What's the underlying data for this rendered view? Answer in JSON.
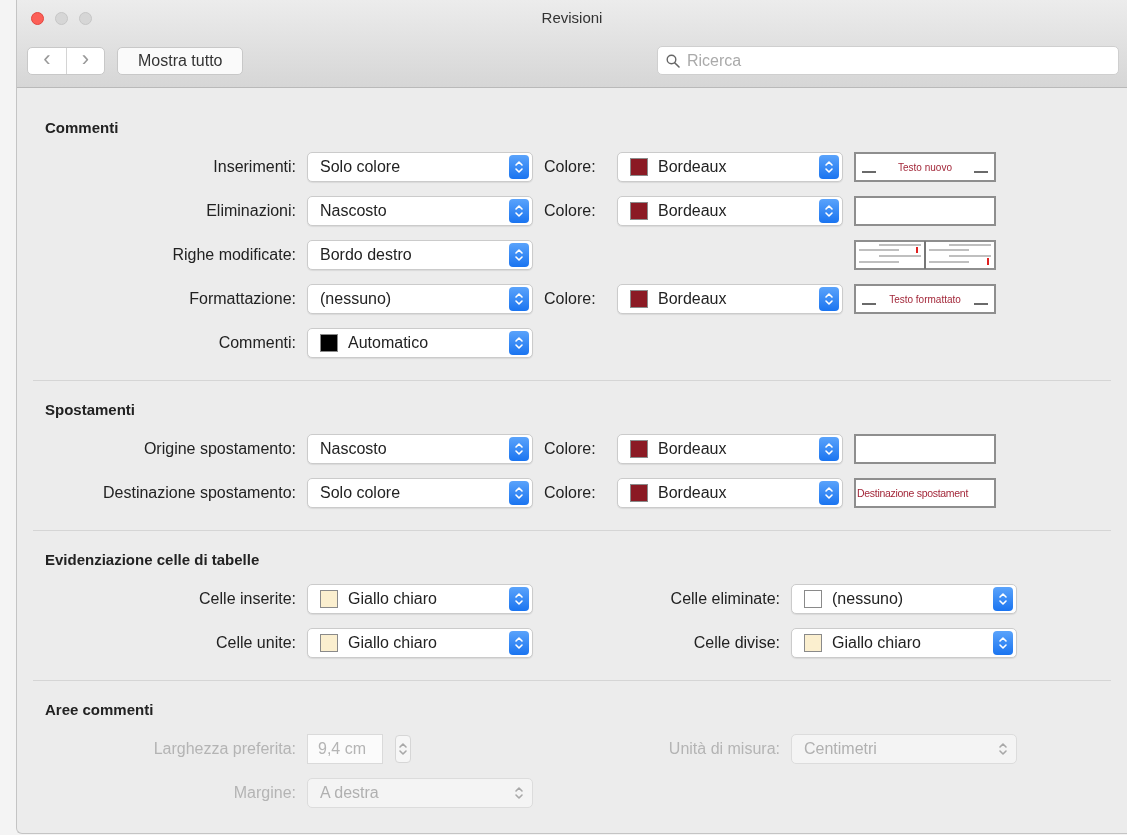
{
  "window": {
    "title": "Revisioni"
  },
  "toolbar": {
    "back": "‹",
    "forward": "›",
    "show_all": "Mostra tutto",
    "search": {
      "placeholder": "Ricerca"
    }
  },
  "sections": [
    {
      "kind": "revisions",
      "title": "Commenti",
      "rows": [
        {
          "label": "Inserimenti:",
          "mode": {
            "value": "Solo colore"
          },
          "color": {
            "label": "Colore:",
            "value": "Bordeaux",
            "color": "#8b1a24"
          },
          "preview": {
            "kind": "marked",
            "text": "Testo nuovo"
          }
        },
        {
          "label": "Eliminazioni:",
          "mode": {
            "value": "Nascosto"
          },
          "color": {
            "label": "Colore:",
            "value": "Bordeaux",
            "color": "#8b1a24"
          },
          "preview": {
            "kind": "empty"
          }
        },
        {
          "label": "Righe modificate:",
          "mode": {
            "value": "Bordo destro"
          },
          "preview": {
            "kind": "lines"
          }
        },
        {
          "label": "Formattazione:",
          "mode": {
            "value": "(nessuno)"
          },
          "color": {
            "label": "Colore:",
            "value": "Bordeaux",
            "color": "#8b1a24"
          },
          "preview": {
            "kind": "marked",
            "text": "Testo formattato"
          }
        },
        {
          "label": "Commenti:",
          "mode": {
            "value": "Automatico",
            "color": "#000000"
          }
        }
      ]
    },
    {
      "kind": "revisions",
      "title": "Spostamenti",
      "rows": [
        {
          "label": "Origine spostamento:",
          "mode": {
            "value": "Nascosto"
          },
          "color": {
            "label": "Colore:",
            "value": "Bordeaux",
            "color": "#8b1a24"
          },
          "preview": {
            "kind": "empty"
          }
        },
        {
          "label": "Destinazione spostamento:",
          "mode": {
            "value": "Solo colore"
          },
          "color": {
            "label": "Colore:",
            "value": "Bordeaux",
            "color": "#8b1a24"
          },
          "preview": {
            "kind": "plain",
            "text": "Destinazione spostament"
          }
        }
      ]
    },
    {
      "kind": "pairs",
      "title": "Evidenziazione celle di tabelle",
      "rows": [
        {
          "cells": [
            {
              "kind": "select",
              "label": "Celle inserite:",
              "value": "Giallo chiaro",
              "color": "#fbefcf",
              "disabled": false
            },
            {
              "kind": "select",
              "label": "Celle eliminate:",
              "value": "(nessuno)",
              "color": "#ffffff",
              "disabled": false
            }
          ]
        },
        {
          "cells": [
            {
              "kind": "select",
              "label": "Celle unite:",
              "value": "Giallo chiaro",
              "color": "#fbefcf",
              "disabled": false
            },
            {
              "kind": "select",
              "label": "Celle divise:",
              "value": "Giallo chiaro",
              "color": "#fbefcf",
              "disabled": false
            }
          ]
        }
      ]
    },
    {
      "kind": "pairs",
      "title": "Aree commenti",
      "rows": [
        {
          "cells": [
            {
              "kind": "number",
              "label": "Larghezza preferita:",
              "value": "9,4 cm",
              "disabled": true
            },
            {
              "kind": "select",
              "label": "Unità di misura:",
              "value": "Centimetri",
              "disabled": true
            }
          ]
        },
        {
          "cells": [
            {
              "kind": "select",
              "label": "Margine:",
              "value": "A destra",
              "disabled": true
            }
          ]
        }
      ]
    }
  ]
}
